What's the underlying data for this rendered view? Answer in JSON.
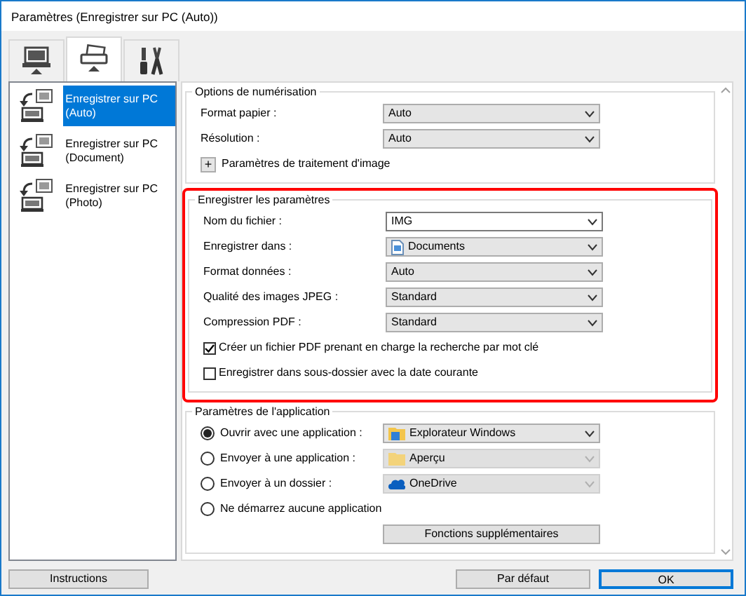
{
  "window": {
    "title": "Paramètres (Enregistrer sur PC (Auto))"
  },
  "tabs": [
    {
      "selected": false
    },
    {
      "selected": true
    },
    {
      "selected": false
    }
  ],
  "modes": [
    {
      "label": "Enregistrer sur PC (Auto)",
      "selected": true
    },
    {
      "label": "Enregistrer sur PC (Document)",
      "selected": false
    },
    {
      "label": "Enregistrer sur PC (Photo)",
      "selected": false
    }
  ],
  "scan_options": {
    "title": "Options de numérisation",
    "fields": [
      {
        "label": "Format papier :",
        "value": "Auto"
      },
      {
        "label": "Résolution :",
        "value": "Auto"
      }
    ],
    "expander": {
      "symbol": "+",
      "label": "Paramètres de traitement d'image"
    }
  },
  "save_settings": {
    "title": "Enregistrer les paramètres",
    "highlighted": true,
    "fields": [
      {
        "label": "Nom du fichier :",
        "value": "IMG",
        "kind": "text"
      },
      {
        "label": "Enregistrer dans :",
        "value": "Documents",
        "kind": "select"
      },
      {
        "label": "Format données :",
        "value": "Auto",
        "kind": "select"
      },
      {
        "label": "Qualité des images JPEG :",
        "value": "Standard",
        "kind": "select"
      },
      {
        "label": "Compression PDF :",
        "value": "Standard",
        "kind": "select"
      }
    ],
    "checkboxes": [
      {
        "label": "Créer un fichier PDF prenant en charge la recherche par mot clé",
        "checked": true
      },
      {
        "label": "Enregistrer dans sous-dossier avec la date courante",
        "checked": false
      }
    ]
  },
  "app_settings": {
    "title": "Paramètres de l'application",
    "options": [
      {
        "label": "Ouvrir avec une application :",
        "selected": true,
        "value": "Explorateur Windows",
        "disabled": false
      },
      {
        "label": "Envoyer à une application :",
        "selected": false,
        "value": "Aperçu",
        "disabled": true
      },
      {
        "label": "Envoyer à un dossier :",
        "selected": false,
        "value": "OneDrive",
        "disabled": true
      },
      {
        "label": "Ne démarrez aucune application",
        "selected": false
      }
    ],
    "button": "Fonctions supplémentaires"
  },
  "footer": {
    "instructions": "Instructions",
    "defaults": "Par défaut",
    "ok": "OK"
  }
}
